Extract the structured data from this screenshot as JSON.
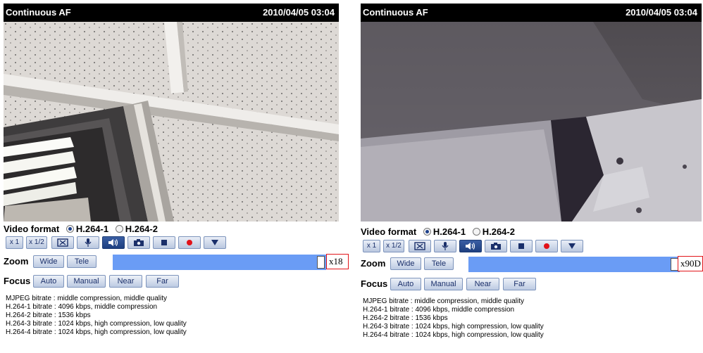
{
  "panels": [
    {
      "title": "Continuous AF",
      "timestamp": "2010/04/05 03:04",
      "video_format_label": "Video format",
      "format_options": [
        "H.264-1",
        "H.264-2"
      ],
      "selected_format": "H.264-1",
      "toolbar": {
        "x1": "x 1",
        "half": "x 1/2",
        "fit_icon": "fit-screen-icon",
        "mic_icon": "microphone-icon",
        "speaker_icon": "speaker-icon",
        "camera_icon": "camera-icon",
        "stop_icon": "stop-icon",
        "record_icon": "record-icon",
        "menu_icon": "dropdown-arrow-icon"
      },
      "zoom_label": "Zoom",
      "zoom_wide": "Wide",
      "zoom_tele": "Tele",
      "zoom_value": "x18",
      "zoom_level": 1.0,
      "focus_label": "Focus",
      "focus_buttons": {
        "auto": "Auto",
        "manual": "Manual",
        "near": "Near",
        "far": "Far"
      },
      "bitrates": [
        "MJPEG bitrate : middle compression, middle quality",
        "H.264-1 bitrate : 4096 kbps, middle compression",
        "H.264-2 bitrate : 1536 kbps",
        "H.264-3 bitrate : 1024 kbps, high compression, low quality",
        "H.264-4 bitrate : 1024 kbps, high compression, low quality"
      ]
    },
    {
      "title": "Continuous AF",
      "timestamp": "2010/04/05 03:04",
      "video_format_label": "Video format",
      "format_options": [
        "H.264-1",
        "H.264-2"
      ],
      "selected_format": "H.264-1",
      "toolbar": {
        "x1": "x 1",
        "half": "x 1/2",
        "fit_icon": "fit-screen-icon",
        "mic_icon": "microphone-icon",
        "speaker_icon": "speaker-icon",
        "camera_icon": "camera-icon",
        "stop_icon": "stop-icon",
        "record_icon": "record-icon",
        "menu_icon": "dropdown-arrow-icon"
      },
      "zoom_label": "Zoom",
      "zoom_wide": "Wide",
      "zoom_tele": "Tele",
      "zoom_value": "x90D",
      "zoom_level": 1.0,
      "focus_label": "Focus",
      "focus_buttons": {
        "auto": "Auto",
        "manual": "Manual",
        "near": "Near",
        "far": "Far"
      },
      "bitrates": [
        "MJPEG bitrate : middle compression, middle quality",
        "H.264-1 bitrate : 4096 kbps, middle compression",
        "H.264-2 bitrate : 1536 kbps",
        "H.264-3 bitrate : 1024 kbps, high compression, low quality",
        "H.264-4 bitrate : 1024 kbps, high compression, low quality"
      ]
    }
  ]
}
